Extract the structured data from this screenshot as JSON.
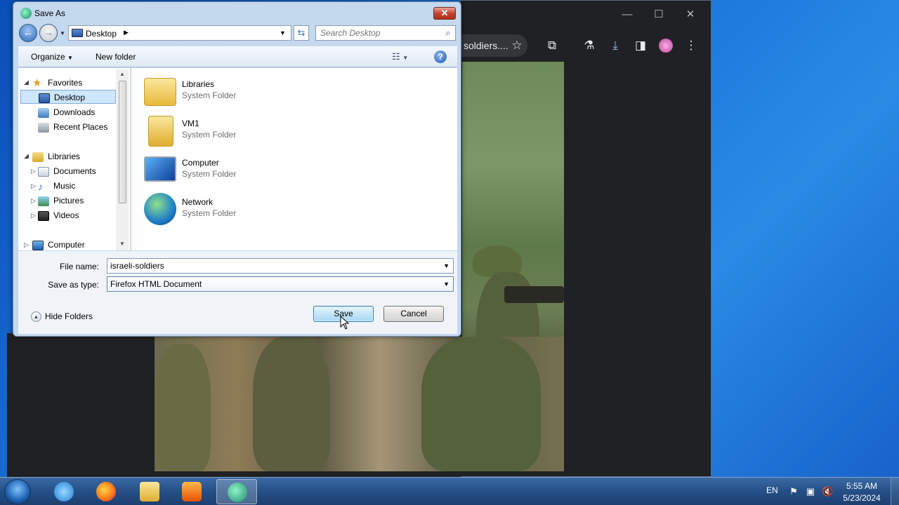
{
  "dialog": {
    "title": "Save As",
    "close_glyph": "✕",
    "address": {
      "location": "Desktop",
      "icon": "desktop-icon"
    },
    "search": {
      "placeholder": "Search Desktop"
    },
    "toolbar": {
      "organize_label": "Organize",
      "new_folder_label": "New folder",
      "help_glyph": "?"
    },
    "nav_pane": {
      "items": [
        {
          "label": "Favorites",
          "icon": "star-icon"
        },
        {
          "label": "Desktop",
          "icon": "desktop-icon",
          "selected": true
        },
        {
          "label": "Downloads",
          "icon": "downloads-folder-icon"
        },
        {
          "label": "Recent Places",
          "icon": "recent-places-icon"
        },
        {
          "label": "Libraries",
          "icon": "libraries-icon"
        },
        {
          "label": "Documents",
          "icon": "documents-icon"
        },
        {
          "label": "Music",
          "icon": "music-icon"
        },
        {
          "label": "Pictures",
          "icon": "pictures-icon"
        },
        {
          "label": "Videos",
          "icon": "videos-icon"
        },
        {
          "label": "Computer",
          "icon": "computer-icon"
        }
      ]
    },
    "files": [
      {
        "name": "Libraries",
        "type": "System Folder",
        "icon": "libraries-folder-icon"
      },
      {
        "name": "VM1",
        "type": "System Folder",
        "icon": "user-folder-icon"
      },
      {
        "name": "Computer",
        "type": "System Folder",
        "icon": "computer-icon"
      },
      {
        "name": "Network",
        "type": "System Folder",
        "icon": "network-icon"
      }
    ],
    "file_name_label": "File name:",
    "file_name_value": "israeli-soldiers",
    "save_as_type_label": "Save as type:",
    "save_as_type_value": "Firefox HTML Document",
    "hide_folders_label": "Hide Folders",
    "save_label": "Save",
    "cancel_label": "Cancel"
  },
  "browser": {
    "tab_text": "soldiers....",
    "minimize_glyph": "—",
    "maximize_glyph": "☐",
    "close_glyph": "✕"
  },
  "taskbar": {
    "apps": [
      "internet-explorer-icon",
      "firefox-icon",
      "file-explorer-icon",
      "media-player-icon",
      "browser-app-icon"
    ],
    "language": "EN",
    "time": "5:55 AM",
    "date": "5/23/2024"
  },
  "colors": {
    "dialog_frame": "#c4d8ee",
    "selection": "#cde6fb",
    "taskbar": "#254f86",
    "close_red": "#c7432d"
  }
}
